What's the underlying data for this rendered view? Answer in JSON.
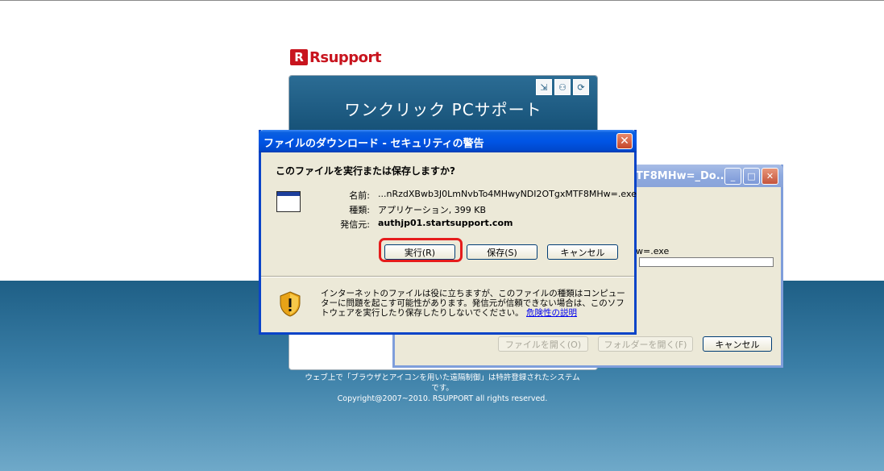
{
  "logo": {
    "mark": "R",
    "text": "Rsupport"
  },
  "main_panel": {
    "title": "ワンクリック PCサポート",
    "footer_line1": "ウェブ上で「ブラウザとアイコンを用いた遠隔制御」は特許登録されたシステム",
    "footer_line2": "です。",
    "copyright": "Copyright@2007~2010. RSUPPORT all rights reserved."
  },
  "bg_window": {
    "title_partial": "TF8MHw=_Do...",
    "filename_partial": "w=.exe",
    "buttons": {
      "open": "ファイルを開く(O)",
      "open_folder": "フォルダーを開く(F)",
      "cancel": "キャンセル"
    }
  },
  "dialog": {
    "title": "ファイルのダウンロード - セキュリティの警告",
    "question": "このファイルを実行または保存しますか?",
    "name_label": "名前:",
    "name_value": "...nRzdXBwb3J0LmNvbTo4MHwyNDI2OTgxMTF8MHw=.exe",
    "type_label": "種類:",
    "type_value": "アプリケーション, 399 KB",
    "from_label": "発信元:",
    "from_value": "authjp01.startsupport.com",
    "buttons": {
      "run": "実行(R)",
      "save": "保存(S)",
      "cancel": "キャンセル"
    },
    "warning_text": "インターネットのファイルは役に立ちますが、このファイルの種類はコンピューターに問題を起こす可能性があります。発信元が信頼できない場合は、このソフトウェアを実行したり保存したりしないでください。",
    "warning_link": "危険性の説明"
  }
}
